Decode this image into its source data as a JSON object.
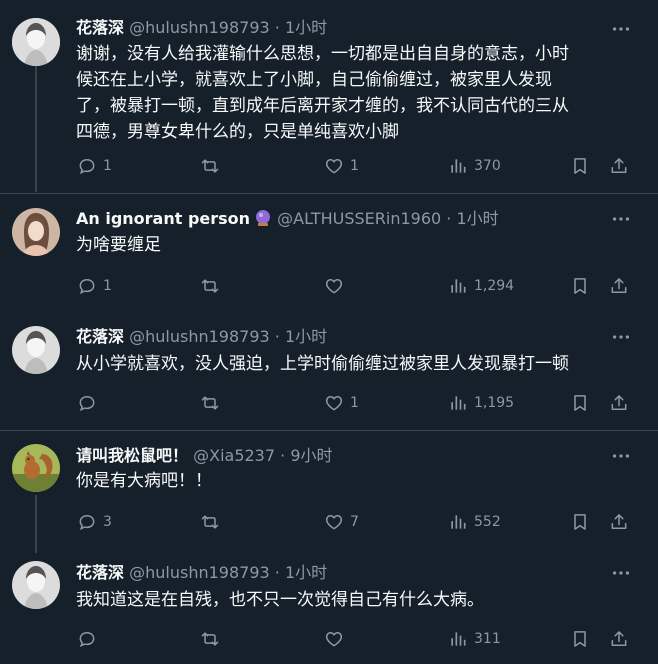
{
  "colors": {
    "background": "#15202b",
    "text": "#f7f9f9",
    "muted": "#8b98a5",
    "divider": "#38444d"
  },
  "icons": {
    "more": "more-dots-icon",
    "reply": "reply-bubble-icon",
    "retweet": "retweet-icon",
    "like": "heart-icon",
    "views": "analytics-bars-icon",
    "bookmark": "bookmark-icon",
    "share": "share-upload-icon",
    "badge": "purple-crystal-ball-icon"
  },
  "tweets": [
    {
      "name": "花落深",
      "handle": "@hulushn198793",
      "time": "· 1小时",
      "lines": [
        "谢谢，没有人给我灌输什么思想，一切都是出自自身的意志，小时",
        "候还在上小学，就喜欢上了小脚，自己偷偷缠过，被家里人发现",
        "了，被暴打一顿，直到成年后离开家才缠的，我不认同古代的三从",
        "四德，男尊女卑什么的，只是单纯喜欢小脚"
      ],
      "replies": "1",
      "retweets": "",
      "likes": "1",
      "views": "370"
    },
    {
      "name": "An ignorant person",
      "handle": "@ALTHUSSERin1960",
      "time": "· 1小时",
      "lines": [
        "为啥要缠足"
      ],
      "replies": "1",
      "retweets": "",
      "likes": "",
      "views": "1,294"
    },
    {
      "name": "花落深",
      "handle": "@hulushn198793",
      "time": "· 1小时",
      "lines": [
        "从小学就喜欢，没人强迫，上学时偷偷缠过被家里人发现暴打一顿"
      ],
      "replies": "",
      "retweets": "",
      "likes": "1",
      "views": "1,195"
    },
    {
      "name": "请叫我松鼠吧！",
      "handle": "@Xia5237",
      "time": "· 9小时",
      "lines": [
        "你是有大病吧！！"
      ],
      "replies": "3",
      "retweets": "",
      "likes": "7",
      "views": "552"
    },
    {
      "name": "花落深",
      "handle": "@hulushn198793",
      "time": "· 1小时",
      "lines": [
        "我知道这是在自残，也不只一次觉得自己有什么大病。"
      ],
      "replies": "",
      "retweets": "",
      "likes": "",
      "views": "311"
    }
  ]
}
